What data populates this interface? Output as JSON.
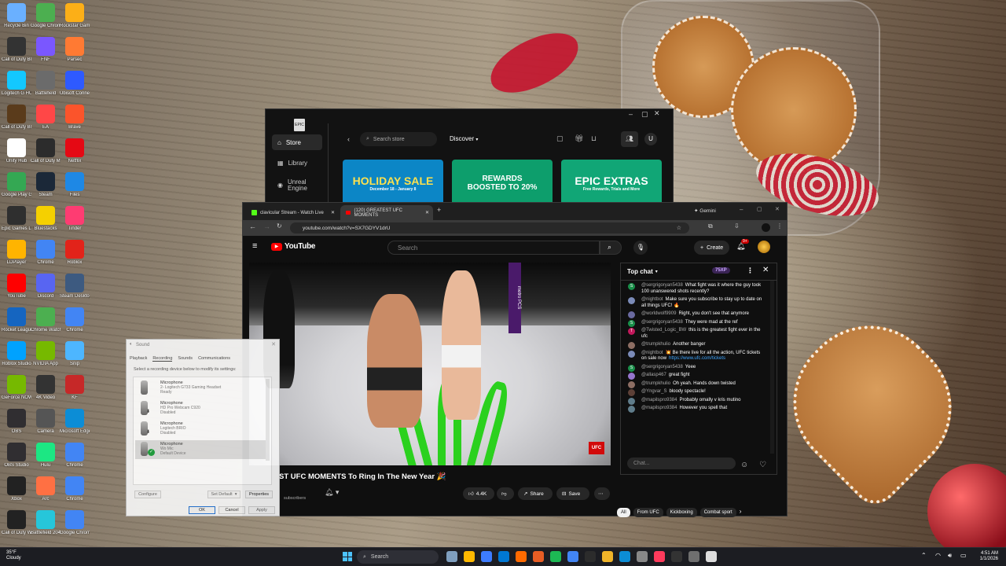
{
  "desktop": {
    "icons": [
      {
        "label": "Recycle Bin",
        "color": "#6ab0ff"
      },
      {
        "label": "Google Chrome",
        "color": "#4caf50"
      },
      {
        "label": "Rockstar Games",
        "color": "#fcaf17"
      },
      {
        "label": "Call of Duty Black Ops III",
        "color": "#333333"
      },
      {
        "label": "FNF",
        "color": "#7a57ff"
      },
      {
        "label": "Parsec",
        "color": "#ff7a33"
      },
      {
        "label": "Logitech G HUB",
        "color": "#13c8ff"
      },
      {
        "label": "Battlefield",
        "color": "#6b6b6b"
      },
      {
        "label": "Ubisoft Connect",
        "color": "#2e5aff"
      },
      {
        "label": "Call of Duty Black Ops",
        "color": "#5a3b1b"
      },
      {
        "label": "EA",
        "color": "#ff4747"
      },
      {
        "label": "Brave",
        "color": "#fb542b"
      },
      {
        "label": "Unity Hub",
        "color": "#ffffff"
      },
      {
        "label": "Call of Duty MW",
        "color": "#2c2c2c"
      },
      {
        "label": "Netflix",
        "color": "#e50914"
      },
      {
        "label": "Google Play Games",
        "color": "#34a853"
      },
      {
        "label": "Steam",
        "color": "#1b2838"
      },
      {
        "label": "Files",
        "color": "#1e88e5"
      },
      {
        "label": "Epic Games Launcher",
        "color": "#2f2f2f"
      },
      {
        "label": "Bluestacks",
        "color": "#f5d000"
      },
      {
        "label": "Tinder",
        "color": "#fe3c72"
      },
      {
        "label": "LDPlayer",
        "color": "#ffb400"
      },
      {
        "label": "Chrome",
        "color": "#4285f4"
      },
      {
        "label": "Roblox",
        "color": "#e2231a"
      },
      {
        "label": "YouTube",
        "color": "#ff0000"
      },
      {
        "label": "Discord",
        "color": "#5865f2"
      },
      {
        "label": "Steam Desktop",
        "color": "#3d5a80"
      },
      {
        "label": "Rocket League",
        "color": "#1565c0"
      },
      {
        "label": "Chrome Watch",
        "color": "#4caf50"
      },
      {
        "label": "Chrome",
        "color": "#4285f4"
      },
      {
        "label": "Roblox Studio",
        "color": "#00a2ff"
      },
      {
        "label": "NVIDIA App",
        "color": "#76b900"
      },
      {
        "label": "Snip",
        "color": "#4db6ff"
      },
      {
        "label": "GeForce NOW",
        "color": "#76b900"
      },
      {
        "label": "4K Video",
        "color": "#333333"
      },
      {
        "label": "KF",
        "color": "#c62828"
      },
      {
        "label": "OBS",
        "color": "#302e31"
      },
      {
        "label": "Camera",
        "color": "#555555"
      },
      {
        "label": "Microsoft Edge",
        "color": "#0c8dd6"
      },
      {
        "label": "OBS Studio",
        "color": "#302e31"
      },
      {
        "label": "Hulu",
        "color": "#1ce783"
      },
      {
        "label": "Chrome",
        "color": "#4285f4"
      },
      {
        "label": "Xbox",
        "color": "#222222"
      },
      {
        "label": "Arc",
        "color": "#ff7043"
      },
      {
        "label": "Chrome",
        "color": "#4285f4"
      },
      {
        "label": "Call of Duty WWII",
        "color": "#222222"
      },
      {
        "label": "Battlefield 2042",
        "color": "#26c6da"
      },
      {
        "label": "Google Chrome",
        "color": "#4285f4"
      }
    ]
  },
  "epic": {
    "logo": "EPIC",
    "nav": [
      {
        "label": "Store"
      },
      {
        "label": "Library"
      },
      {
        "label": "Unreal Engine"
      }
    ],
    "search_placeholder": "Search store",
    "discover": "Discover",
    "avatar": "U",
    "tiles": [
      {
        "text": "HOLIDAY SALE",
        "sub": "December 18 - January 8",
        "color": "#0c86c6"
      },
      {
        "text": "REWARDS BOOSTED TO 20%",
        "sub": "",
        "color": "#0d9e6c"
      },
      {
        "text": "EPIC EXTRAS",
        "sub": "Free Rewards, Trials and More",
        "color": "#11a676"
      }
    ]
  },
  "chrome": {
    "tabs": [
      {
        "label": "clavicular Stream - Watch Live"
      },
      {
        "label": "(120) GREATEST UFC MOMENTS"
      }
    ],
    "gemini": "Gemini",
    "url": "youtube.com/watch?v=SX7GDYV1drU"
  },
  "youtube": {
    "logo": "YouTube",
    "search_placeholder": "Search",
    "create": "Create",
    "notif_count": "9+",
    "video_title": "ST UFC MOMENTS To Ring In The New Year 🎉",
    "subscribers": "subscribers",
    "likes": "4.4K",
    "share": "Share",
    "save": "Save",
    "ufc": "UFC",
    "banner": "metro PCS",
    "chat": {
      "header": "Top chat",
      "xp": "75XP",
      "input_placeholder": "Chat...",
      "messages": [
        {
          "author": "@sergrigoryan5438",
          "text": "What fight was it where the guy took 100 unanswered shots recently?",
          "av": "S",
          "color": "#1a8f4a"
        },
        {
          "author": "@nightbot",
          "text": "Make sure you subscribe to stay up to date on all things UFC! 🔥",
          "av": "",
          "color": "#7b8bb8"
        },
        {
          "author": "@worldwolf9909",
          "text": "Right, you don't see that anymore",
          "av": "",
          "color": "#6a6aa0"
        },
        {
          "author": "@sergrigoryan5438",
          "text": "They were mad at the ref",
          "av": "S",
          "color": "#1a8f4a"
        },
        {
          "author": "@Twisted_Logic_BW",
          "text": "this is the greatest fight ever in the ufc",
          "av": "T",
          "color": "#c2185b"
        },
        {
          "author": "@trumpkhulio",
          "text": "Another banger",
          "av": "",
          "color": "#8d6e63"
        },
        {
          "author": "@nightbot",
          "text": "💥 Be there live for all the action, UFC tickets on sale now",
          "link": "https://www.ufc.com/tickets",
          "av": "",
          "color": "#7b8bb8"
        },
        {
          "author": "@sergrigoryan5438",
          "text": "Yeee",
          "av": "S",
          "color": "#1a8f4a"
        },
        {
          "author": "@allasp467",
          "text": "great fight",
          "av": "",
          "color": "#9575cd"
        },
        {
          "author": "@trumpkhulio",
          "text": "Oh yeah. Hands down twisted",
          "av": "",
          "color": "#8d6e63"
        },
        {
          "author": "@Yngvar_S",
          "text": "bloody spectacle!",
          "av": "",
          "color": "#5d4037"
        },
        {
          "author": "@mapilspro9384",
          "text": "Probably omally v kris mutino",
          "av": "",
          "color": "#607d8b"
        },
        {
          "author": "@mapilspro9384",
          "text": "However you spell that",
          "av": "",
          "color": "#607d8b"
        }
      ]
    },
    "chips": [
      "All",
      "From UFC",
      "Kickboxing",
      "Combat sport"
    ]
  },
  "sound": {
    "title": "Sound",
    "tabs": [
      "Playback",
      "Recording",
      "Sounds",
      "Communications"
    ],
    "hint": "Select a recording device below to modify its settings:",
    "devices": [
      {
        "name": "Microphone",
        "model": "2- Logitech G733 Gaming Headset",
        "status": "Ready"
      },
      {
        "name": "Microphone",
        "model": "HD Pro Webcam C920",
        "status": "Disabled"
      },
      {
        "name": "Microphone",
        "model": "Logitech BRIO",
        "status": "Disabled"
      },
      {
        "name": "Microphone",
        "model": "Wo Mic",
        "status": "Default Device"
      }
    ],
    "configure": "Configure",
    "set_default": "Set Default",
    "properties": "Properties",
    "ok": "OK",
    "cancel": "Cancel",
    "apply": "Apply"
  },
  "taskbar": {
    "temp": "35°F",
    "weather": "Cloudy",
    "search": "Search",
    "time": "4:51 AM",
    "date": "1/1/2026"
  }
}
